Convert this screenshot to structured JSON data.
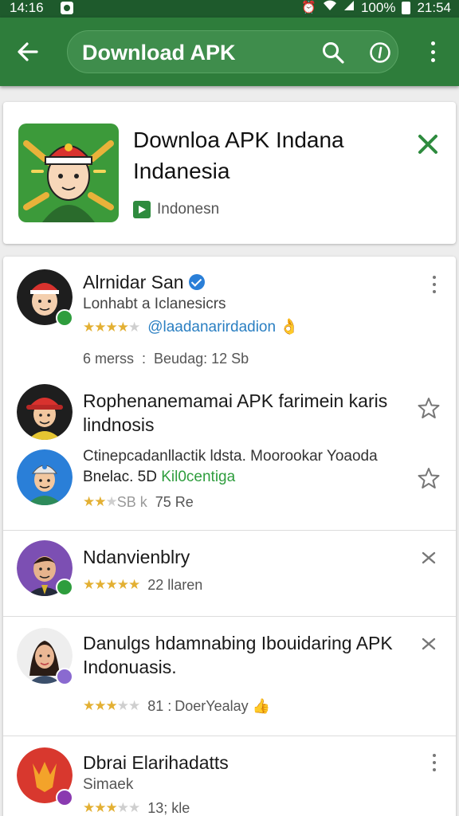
{
  "status_bar": {
    "time": "14:16",
    "battery": "100%",
    "clock": "21:54"
  },
  "toolbar": {
    "title": "Download APK"
  },
  "banner": {
    "title_line1": "Downloa APK Indana",
    "title_line2": "Indanesia",
    "badge_label": "Indonesn"
  },
  "list": {
    "items": [
      {
        "name": "Alrnidar San",
        "subtitle": "Lonhabt a Iclanesicrs",
        "link": "@laadanarirdadion",
        "link_emoji": "👌",
        "meta_left": "6 merss",
        "meta_sep": ":",
        "meta_right": "Beudag: 12 Sb",
        "rating": 4
      },
      {
        "name_line1": "Rophenanemamai APK farimein karis",
        "name_line2": "lindnosis"
      },
      {
        "subtitle": "Ctinepcadanllactik ldsta. Moorookar Yoaoda",
        "line2_prefix": "Bnelac. 5D",
        "line2_link": "Kil0centiga",
        "meta_left": "SB k",
        "meta_right": "75 Re",
        "rating": 2
      },
      {
        "name": "Ndanvienblry",
        "meta_right": "22 llaren",
        "rating": 5
      },
      {
        "name_line1": "Danulgs hdamnabing Ibouidaring APK",
        "name_line2": "Indonuasis.",
        "meta_left": "81 :",
        "meta_right": "DoerYealay",
        "meta_emoji": "👍",
        "rating": 3
      },
      {
        "name": "Dbrai Elarihadatts",
        "subtitle": "Simaek",
        "meta_right": "13; kle",
        "rating": 3
      }
    ]
  },
  "colors": {
    "toolbar": "#2e7d3b",
    "status_bar": "#1e5a2c",
    "accent_green": "#2e9d3d",
    "star": "#e3b033",
    "link_blue": "#2a7fc2"
  },
  "icons": [
    "back-arrow-icon",
    "search-icon",
    "info-icon",
    "more-vert-icon",
    "close-icon",
    "star-outline-icon",
    "dismiss-icon",
    "verified-check-icon"
  ]
}
